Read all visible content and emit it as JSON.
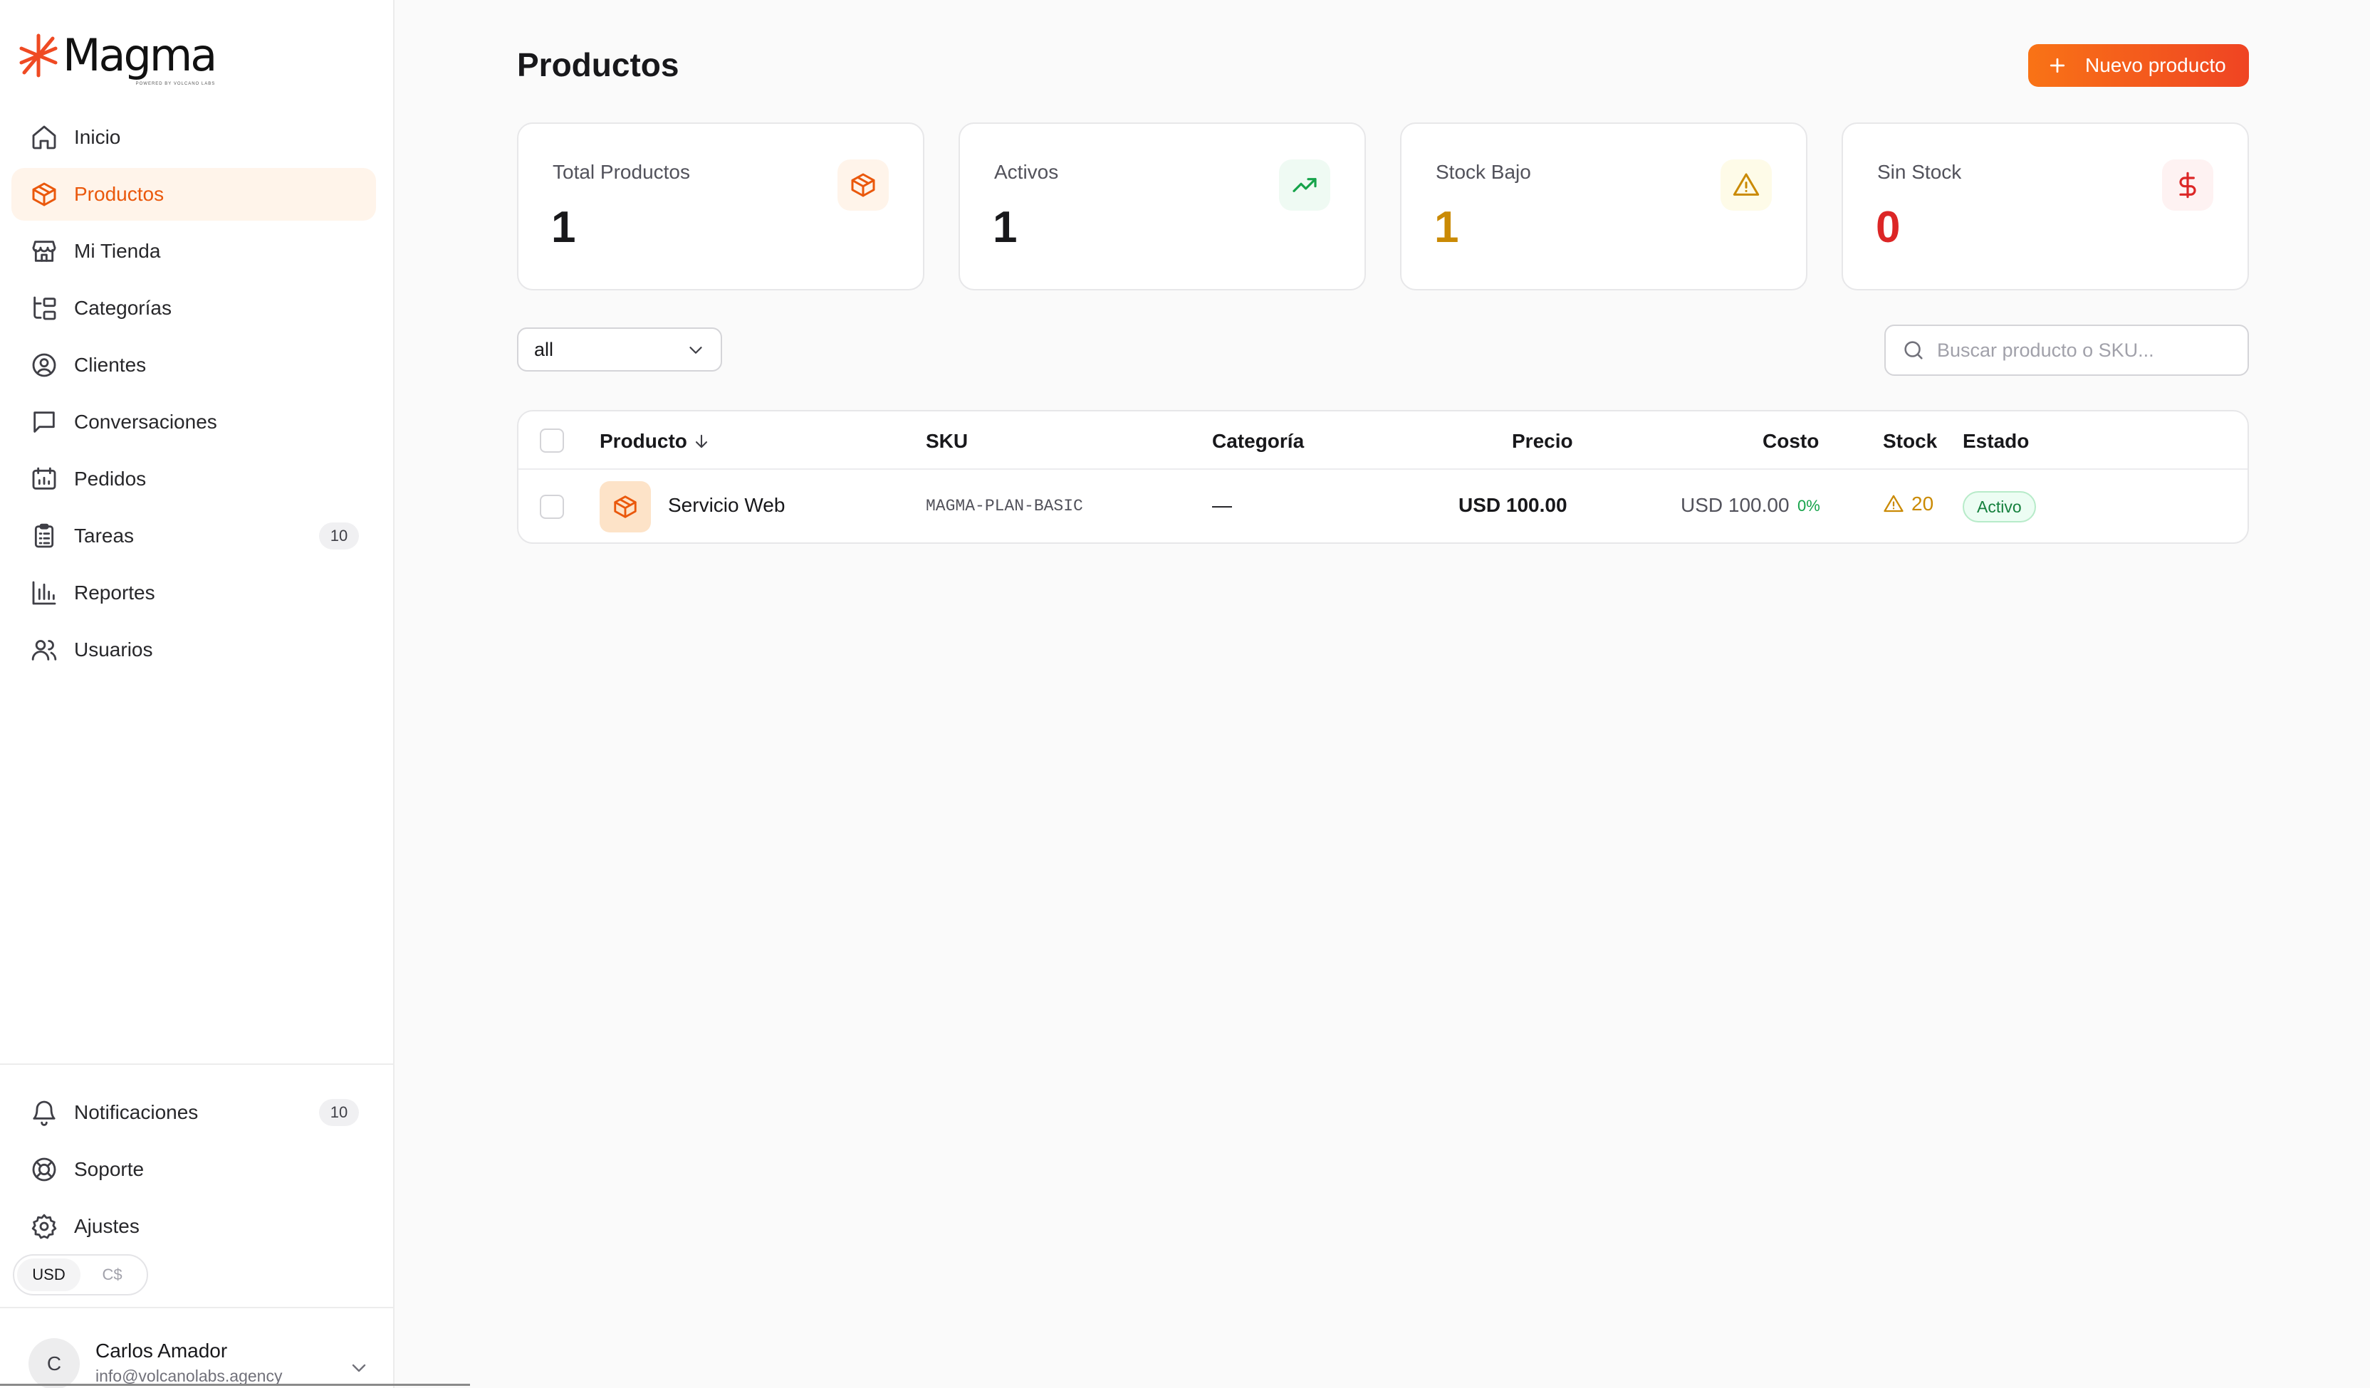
{
  "app": {
    "logo_text": "Magma",
    "logo_subtext": "POWERED BY VOLCANO LABS"
  },
  "colors": {
    "accent": "#ea580c",
    "accent_bg": "#fff4ea",
    "warning": "#ca8a04",
    "danger": "#dc2626",
    "success": "#16a34a"
  },
  "sidebar": {
    "items": [
      {
        "label": "Inicio",
        "icon": "home-icon",
        "active": false
      },
      {
        "label": "Productos",
        "icon": "box-icon",
        "active": true
      },
      {
        "label": "Mi Tienda",
        "icon": "store-icon",
        "active": false
      },
      {
        "label": "Categorías",
        "icon": "folder-tree-icon",
        "active": false
      },
      {
        "label": "Clientes",
        "icon": "user-circle-icon",
        "active": false
      },
      {
        "label": "Conversaciones",
        "icon": "message-square-icon",
        "active": false
      },
      {
        "label": "Pedidos",
        "icon": "receipt-icon",
        "active": false
      },
      {
        "label": "Tareas",
        "icon": "clipboard-list-icon",
        "active": false,
        "badge": "10"
      },
      {
        "label": "Reportes",
        "icon": "bar-chart-icon",
        "active": false
      },
      {
        "label": "Usuarios",
        "icon": "users-icon",
        "active": false
      }
    ],
    "bottom_items": [
      {
        "label": "Notificaciones",
        "icon": "bell-icon",
        "badge": "10"
      },
      {
        "label": "Soporte",
        "icon": "life-buoy-icon"
      },
      {
        "label": "Ajustes",
        "icon": "gear-icon"
      }
    ],
    "currency": {
      "options": [
        "USD",
        "C$"
      ],
      "selected": "USD"
    },
    "user": {
      "initial": "C",
      "name": "Carlos Amador",
      "email": "info@volcanolabs.agency"
    }
  },
  "main": {
    "title": "Productos",
    "new_button_label": "Nuevo producto",
    "stats": [
      {
        "label": "Total Productos",
        "value": "1",
        "icon": "box-icon",
        "color": "#18181b",
        "icon_color": "#ea580c",
        "icon_bg": "#fff4ea"
      },
      {
        "label": "Activos",
        "value": "1",
        "icon": "trending-up-icon",
        "color": "#18181b",
        "icon_color": "#16a34a",
        "icon_bg": "#effaf3"
      },
      {
        "label": "Stock Bajo",
        "value": "1",
        "icon": "alert-triangle-icon",
        "color": "#ca8a04",
        "icon_color": "#ca8a04",
        "icon_bg": "#fefbe8"
      },
      {
        "label": "Sin Stock",
        "value": "0",
        "icon": "dollar-icon",
        "color": "#dc2626",
        "icon_color": "#dc2626",
        "icon_bg": "#fef2f2"
      }
    ],
    "filter": {
      "selected": "all"
    },
    "search": {
      "placeholder": "Buscar producto o SKU...",
      "value": ""
    },
    "table": {
      "columns": {
        "product": "Producto",
        "sku": "SKU",
        "category": "Categoría",
        "price": "Precio",
        "cost": "Costo",
        "stock": "Stock",
        "status": "Estado"
      },
      "rows": [
        {
          "product": "Servicio Web",
          "sku": "MAGMA-PLAN-BASIC",
          "category": "—",
          "price": "USD 100.00",
          "cost": "USD 100.00",
          "margin": "0%",
          "stock": "20",
          "status": "Activo"
        }
      ]
    }
  }
}
